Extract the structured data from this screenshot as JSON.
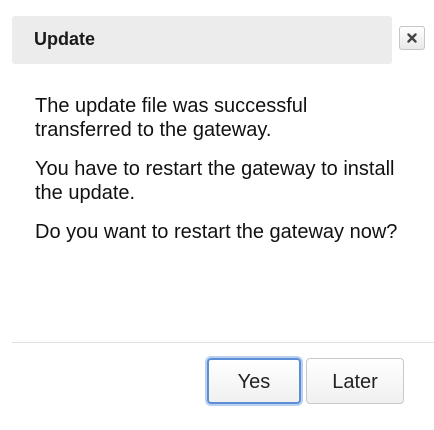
{
  "dialog": {
    "title": "Update",
    "close_icon": "close-x-icon",
    "messages": [
      "The update file was successful transferred to the gateway.",
      "You have to restart the gateway to install the update.",
      "Do you want to restart the gateway now?"
    ],
    "buttons": {
      "yes_label": "Yes",
      "later_label": "Later"
    },
    "colors": {
      "focus_ring": "#5b8ed6",
      "titlebar_bg": "#ececec"
    }
  }
}
